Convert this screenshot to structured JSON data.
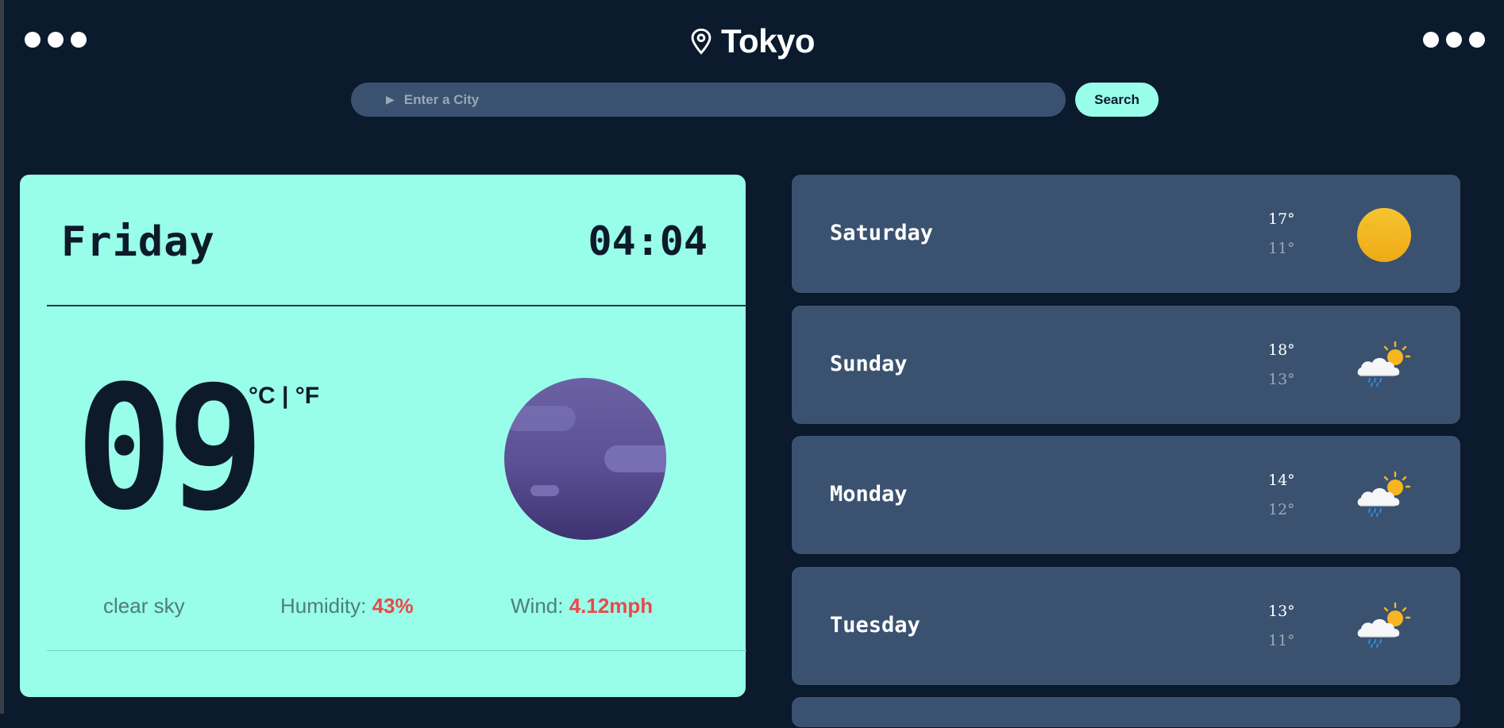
{
  "header": {
    "city": "Tokyo",
    "location_icon": "location-pin-icon",
    "menu_icon": "more-dots-icon"
  },
  "search": {
    "placeholder": "Enter a City",
    "button_label": "Search"
  },
  "current": {
    "day": "Friday",
    "time": "04:04",
    "temperature": "09",
    "units": "°C | °F",
    "condition_icon": "moon-clear-night-icon",
    "description": "clear sky",
    "humidity_label": "Humidity:",
    "humidity_value": "43%",
    "wind_label": "Wind:",
    "wind_value": "4.12mph"
  },
  "forecast": [
    {
      "day": "Saturday",
      "high": "17°",
      "low": "11°",
      "icon": "sun-icon"
    },
    {
      "day": "Sunday",
      "high": "18°",
      "low": "13°",
      "icon": "sun-cloud-rain-icon"
    },
    {
      "day": "Monday",
      "high": "14°",
      "low": "12°",
      "icon": "sun-cloud-rain-icon"
    },
    {
      "day": "Tuesday",
      "high": "13°",
      "low": "11°",
      "icon": "sun-cloud-rain-icon"
    }
  ],
  "colors": {
    "background": "#0b1a2d",
    "accent": "#98fde9",
    "card": "#3a5270",
    "highlight": "#e84a4a"
  }
}
